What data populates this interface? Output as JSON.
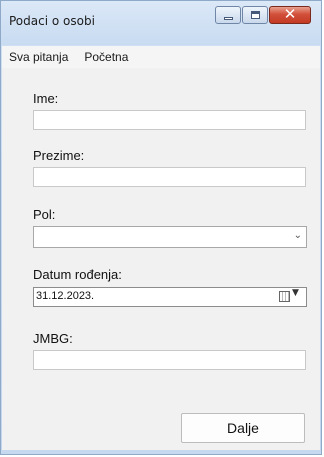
{
  "window": {
    "title": "Podaci o osobi"
  },
  "menu": {
    "items": [
      "Sva pitanja",
      "Početna"
    ]
  },
  "form": {
    "ime_label": "Ime:",
    "ime_value": "",
    "prezime_label": "Prezime:",
    "prezime_value": "",
    "pol_label": "Pol:",
    "pol_value": "",
    "datum_label": "Datum rođenja:",
    "datum_value": "31.12.2023.",
    "jmbg_label": "JMBG:",
    "jmbg_value": "",
    "next_button": "Dalje"
  },
  "icons": {
    "minimize": "minimize-icon",
    "maximize": "maximize-icon",
    "close": "close-icon",
    "dropdown": "chevron-down-icon",
    "calendar": "calendar-icon"
  },
  "colors": {
    "title_bar": "#c8dbf1",
    "close_button": "#d2503a",
    "client_bg": "#f1f1f1"
  }
}
